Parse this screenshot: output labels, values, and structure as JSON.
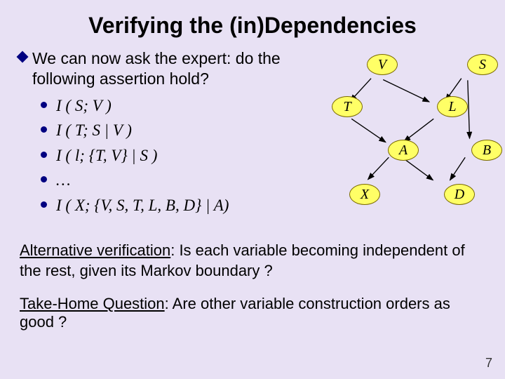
{
  "title": "Verifying the (in)Dependencies",
  "lead": "We can now ask the expert: do the following assertion hold?",
  "items": [
    "I ( S; V )",
    "I ( T; S | V )",
    "I ( l; {T, V} | S )",
    "…",
    "I ( X; {V, S, T, L, B, D} | A)"
  ],
  "alt_label": "Alternative verification",
  "alt_rest": ": Is each variable becoming independent of the rest, given its Markov boundary ?",
  "take_label": "Take-Home Question",
  "take_rest": ": Are other variable construction orders as good ?",
  "page": "7",
  "nodes": {
    "V": "V",
    "S": "S",
    "T": "T",
    "L": "L",
    "A": "A",
    "B": "B",
    "X": "X",
    "D": "D"
  }
}
